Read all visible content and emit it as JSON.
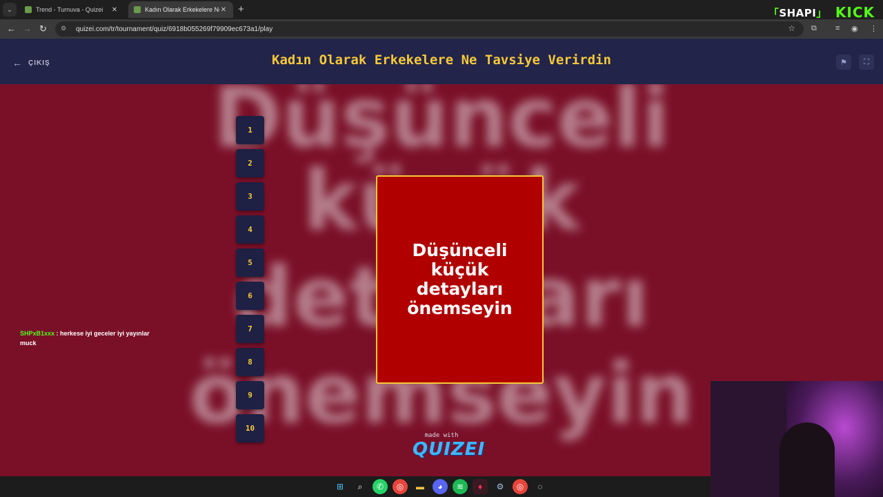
{
  "browser": {
    "tabs": [
      {
        "title": "Trend - Turnuva - Quizei",
        "active": false
      },
      {
        "title": "Kadın Olarak Erkekelere Ne Tavsiye",
        "active": true
      }
    ],
    "url": "quizei.com/tr/tournament/quiz/6918b055269f79909ec673a1/play",
    "brand_left": "SHAPI",
    "brand_right": "KICK"
  },
  "quiz": {
    "exit_label": "ÇIKIŞ",
    "title": "Kadın Olarak Erkekelere Ne Tavsiye Verirdin",
    "question_numbers": [
      "1",
      "2",
      "3",
      "4",
      "5",
      "6",
      "7",
      "8",
      "9",
      "10"
    ],
    "card_text": "Düşünceli küçük detayları önemseyin",
    "background_words": [
      "Düşünceli",
      "küçük",
      "detayları",
      "önemseyin"
    ],
    "made_with": "made with",
    "logo": "QUIZEI"
  },
  "chat": {
    "username": "SHPxB1xxx",
    "message": "herkese iyi geceler iyi yayınlar muck"
  },
  "colors": {
    "accent": "#f7c93a",
    "card": "#b00000",
    "stage": "#7a1028",
    "header": "#22244a",
    "kick_green": "#53fc18"
  },
  "taskbar_icons": [
    "windows-icon",
    "search-icon",
    "whatsapp-icon",
    "chrome-icon",
    "files-icon",
    "discord-icon",
    "spotify-icon",
    "app-icon",
    "steam-icon",
    "chrome-alt-icon",
    "obs-icon"
  ]
}
